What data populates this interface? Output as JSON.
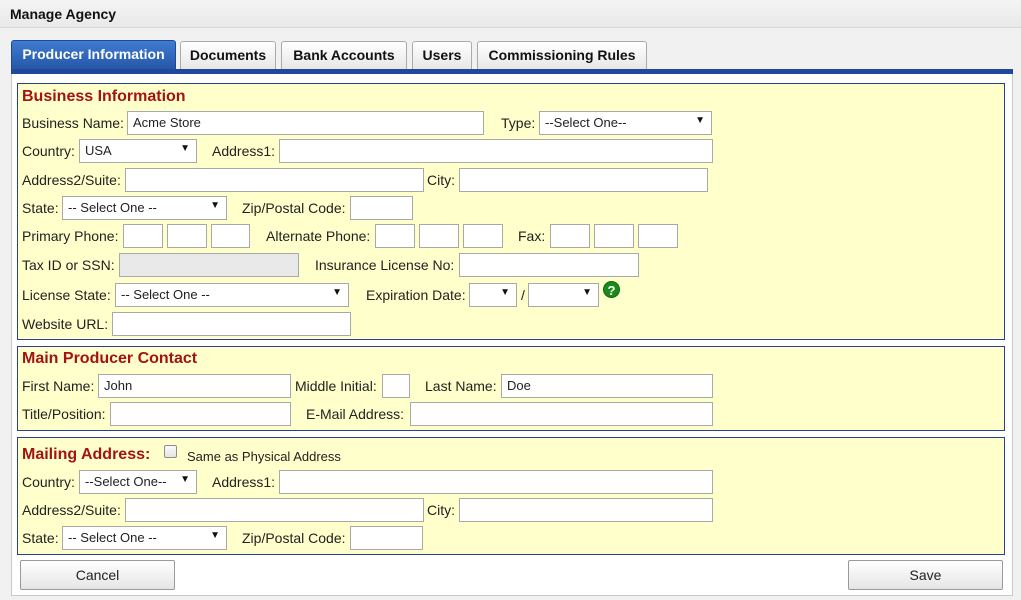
{
  "window": {
    "title": "Manage Agency"
  },
  "tabs": [
    {
      "label": "Producer Information",
      "active": true
    },
    {
      "label": "Documents"
    },
    {
      "label": "Bank Accounts"
    },
    {
      "label": "Users"
    },
    {
      "label": "Commissioning Rules"
    }
  ],
  "business": {
    "title": "Business Information",
    "business_name_label": "Business Name:",
    "business_name_value": "Acme Store",
    "type_label": "Type:",
    "type_value": "--Select One--",
    "country_label": "Country:",
    "country_value": "USA",
    "address1_label": "Address1:",
    "address1_value": "",
    "address2_label": "Address2/Suite:",
    "address2_value": "",
    "city_label": "City:",
    "city_value": "",
    "state_label": "State:",
    "state_value": "-- Select One --",
    "zip_label": "Zip/Postal Code:",
    "zip_value": "",
    "primary_phone_label": "Primary Phone:",
    "alternate_phone_label": "Alternate Phone:",
    "fax_label": "Fax:",
    "tax_id_label": "Tax ID or SSN:",
    "tax_id_value": "",
    "insurance_license_label": "Insurance License No:",
    "insurance_license_value": "",
    "license_state_label": "License State:",
    "license_state_value": "-- Select One --",
    "expiration_label": "Expiration Date:",
    "expiration_month_value": "",
    "expiration_separator": "/",
    "expiration_year_value": "",
    "help_glyph": "?",
    "website_label": "Website URL:",
    "website_value": ""
  },
  "contact": {
    "title": "Main Producer Contact",
    "first_name_label": "First Name:",
    "first_name_value": "John",
    "middle_initial_label": "Middle Initial:",
    "middle_initial_value": "",
    "last_name_label": "Last Name:",
    "last_name_value": "Doe",
    "title_position_label": "Title/Position:",
    "title_position_value": "",
    "email_label": "E-Mail Address:",
    "email_value": ""
  },
  "mailing": {
    "title": "Mailing Address:",
    "same_as_label": "Same as Physical Address",
    "same_as_checked": false,
    "country_label": "Country:",
    "country_value": "--Select One--",
    "address1_label": "Address1:",
    "address1_value": "",
    "address2_label": "Address2/Suite:",
    "address2_value": "",
    "city_label": "City:",
    "city_value": "",
    "state_label": "State:",
    "state_value": "-- Select One --",
    "zip_label": "Zip/Postal Code:",
    "zip_value": ""
  },
  "actions": {
    "cancel_label": "Cancel",
    "save_label": "Save"
  },
  "colors": {
    "accent": "#21489a",
    "section_bg": "#ffffcc",
    "section_title": "#a31313"
  }
}
